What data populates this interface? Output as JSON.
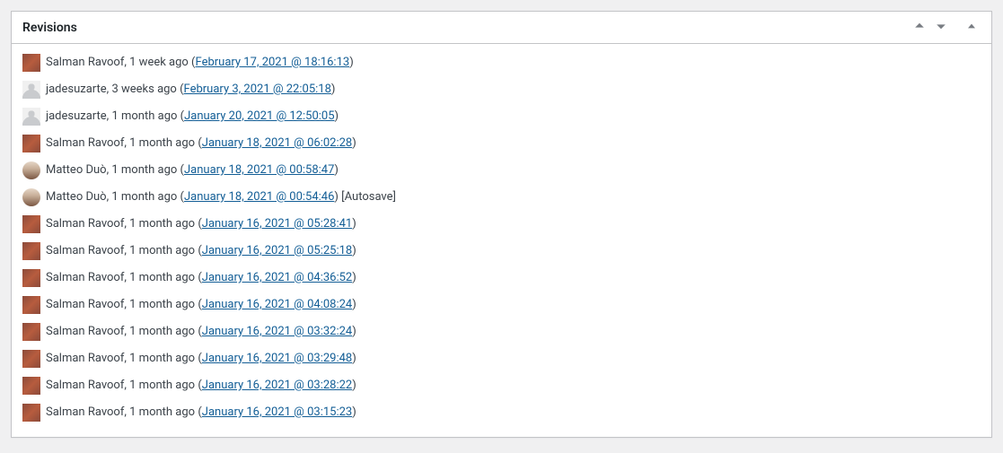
{
  "panel": {
    "title": "Revisions"
  },
  "revisions": [
    {
      "author": "Salman Ravoof",
      "avatar": "salman",
      "relative": "1 week ago",
      "date": "February 17, 2021 @ 18:16:13",
      "suffix": ""
    },
    {
      "author": "jadesuzarte",
      "avatar": "placeholder",
      "relative": "3 weeks ago",
      "date": "February 3, 2021 @ 22:05:18",
      "suffix": ""
    },
    {
      "author": "jadesuzarte",
      "avatar": "placeholder",
      "relative": "1 month ago",
      "date": "January 20, 2021 @ 12:50:05",
      "suffix": ""
    },
    {
      "author": "Salman Ravoof",
      "avatar": "salman",
      "relative": "1 month ago",
      "date": "January 18, 2021 @ 06:02:28",
      "suffix": ""
    },
    {
      "author": "Matteo Duò",
      "avatar": "matteo",
      "relative": "1 month ago",
      "date": "January 18, 2021 @ 00:58:47",
      "suffix": ""
    },
    {
      "author": "Matteo Duò",
      "avatar": "matteo",
      "relative": "1 month ago",
      "date": "January 18, 2021 @ 00:54:46",
      "suffix": " [Autosave]"
    },
    {
      "author": "Salman Ravoof",
      "avatar": "salman",
      "relative": "1 month ago",
      "date": "January 16, 2021 @ 05:28:41",
      "suffix": ""
    },
    {
      "author": "Salman Ravoof",
      "avatar": "salman",
      "relative": "1 month ago",
      "date": "January 16, 2021 @ 05:25:18",
      "suffix": ""
    },
    {
      "author": "Salman Ravoof",
      "avatar": "salman",
      "relative": "1 month ago",
      "date": "January 16, 2021 @ 04:36:52",
      "suffix": ""
    },
    {
      "author": "Salman Ravoof",
      "avatar": "salman",
      "relative": "1 month ago",
      "date": "January 16, 2021 @ 04:08:24",
      "suffix": ""
    },
    {
      "author": "Salman Ravoof",
      "avatar": "salman",
      "relative": "1 month ago",
      "date": "January 16, 2021 @ 03:32:24",
      "suffix": ""
    },
    {
      "author": "Salman Ravoof",
      "avatar": "salman",
      "relative": "1 month ago",
      "date": "January 16, 2021 @ 03:29:48",
      "suffix": ""
    },
    {
      "author": "Salman Ravoof",
      "avatar": "salman",
      "relative": "1 month ago",
      "date": "January 16, 2021 @ 03:28:22",
      "suffix": ""
    },
    {
      "author": "Salman Ravoof",
      "avatar": "salman",
      "relative": "1 month ago",
      "date": "January 16, 2021 @ 03:15:23",
      "suffix": ""
    }
  ]
}
